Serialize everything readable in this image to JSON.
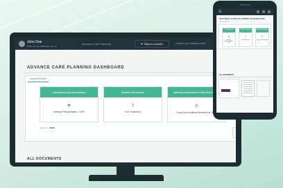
{
  "monitor_app": {
    "user": {
      "name": "John Doe",
      "meta": "DOB: Jan 01, 1985  Male, 34 y/o"
    },
    "nav_title": "Advance Care Planning",
    "report_label": "Report a problem",
    "contact_label": "Contact your institution staff",
    "page_title": "ADVANCE CARE PLANNING DASHBOARD",
    "policy_tab": "Current POLST",
    "policies": [
      {
        "header": "Cardiopulmonary Resuscitation",
        "icon": "heart-icon",
        "glyph": "♥",
        "value": "Attempt Resuscitation / CPR"
      },
      {
        "header": "Medical Interventions",
        "icon": "iv-drip-icon",
        "glyph": "⚕",
        "value": "Full Treatment"
      },
      {
        "header": "Artificially Administered Fluids And Nutrition",
        "icon": "feeding-tube-icon",
        "glyph": "⫛",
        "value": "Long Term Artificial Nutrition by Tube"
      }
    ],
    "updated_label": "Selection: ",
    "updated_value": "VIEW",
    "all_documents_title": "ALL DOCUMENTS"
  },
  "phone_app": {
    "menu_icon": "☰",
    "title": "ADVANCE CARE PLANNING DASHBOARD",
    "subtitle": "Current POLST",
    "policies": [
      {
        "header": "Cardiopulmonary Resuscitation",
        "glyph": "♥",
        "value": "Attempt Resuscitation / CPR"
      },
      {
        "header": "Medical Interventions",
        "glyph": "⚕",
        "value": "Full Treatment"
      },
      {
        "header": "Artificially Administered Fluids",
        "glyph": "⫛",
        "value": "Long Term Nutrition"
      }
    ],
    "all_documents_title": "ALL DOCUMENTS"
  },
  "colors": {
    "accent": "#45b592",
    "topbar": "#23313a",
    "device": "#1d2b33",
    "background": "#cfe9e0"
  }
}
